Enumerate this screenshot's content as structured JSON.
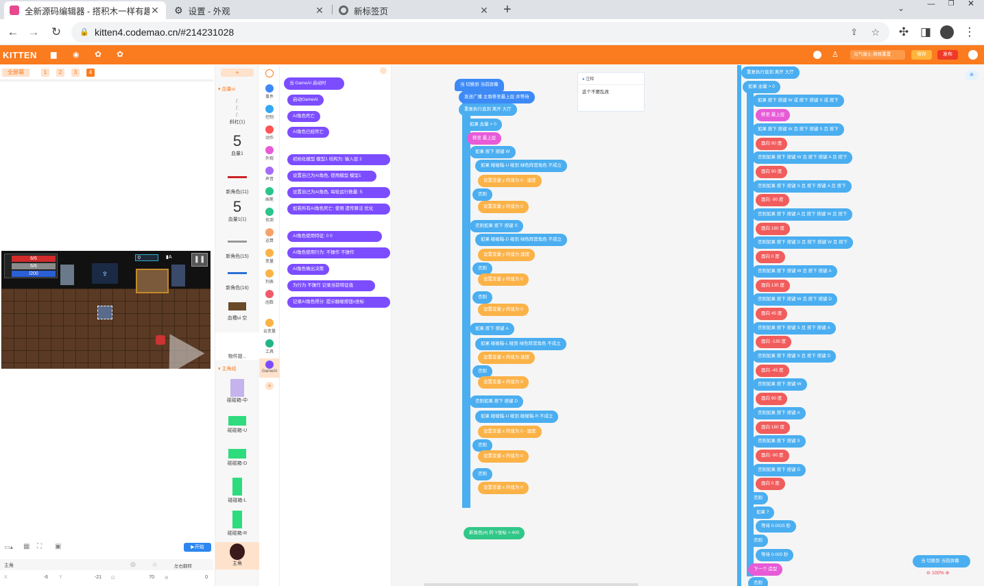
{
  "browser": {
    "tabs": [
      {
        "title": "全新源码编辑器 - 搭积木一样有趣",
        "active": true
      },
      {
        "title": "设置 - 外观",
        "active": false
      },
      {
        "title": "新标签页",
        "active": false
      }
    ],
    "url": "kitten4.codemao.cn/#214231028"
  },
  "app": {
    "logo": "KITTEN",
    "right_badge": "元气骑士-救赎重置",
    "save": "保存",
    "publish": "发布"
  },
  "stage": {
    "fullscreen_label": "全屏幕",
    "scenes": [
      "1",
      "2",
      "3",
      "4"
    ],
    "hud": {
      "hp": "6/6",
      "armor": "6/6",
      "energy": "/200",
      "ammo": "0",
      "key": "A"
    },
    "start_button": "开始",
    "sprite_name": "主角",
    "rotate_label": "左右翻转",
    "x_label": "X",
    "x_value": "-6",
    "y_label": "Y",
    "y_value": "-21",
    "size_value": "70",
    "dir_value": "0"
  },
  "sprites": [
    {
      "label": "血量ui"
    },
    {
      "label": "斜杠(1)"
    },
    {
      "label": "血量1"
    },
    {
      "label": "新角色(11)"
    },
    {
      "label": "血量1(1)"
    },
    {
      "label": "新角色(15)"
    },
    {
      "label": "新角色(16)"
    },
    {
      "label": "血槽ui 空"
    },
    {
      "label": "物件提..."
    },
    {
      "label": "主角组"
    },
    {
      "label": "碰碰箱-中"
    },
    {
      "label": "碰碰箱-U"
    },
    {
      "label": "碰碰箱-D"
    },
    {
      "label": "碰碰箱-L"
    },
    {
      "label": "碰碰箱-R"
    },
    {
      "label": "主角"
    }
  ],
  "categories": [
    "事件",
    "控制",
    "动作",
    "外观",
    "声音",
    "画笔",
    "侦测",
    "运算",
    "变量",
    "列表",
    "函数",
    "云变量",
    "工具",
    "GameAI"
  ],
  "palette": [
    "当 GameAI 启动时",
    "启动GameAI",
    "AI角色死亡",
    "AI角色已经死亡",
    "初始化模型 模型1 结构为: 输入层 2",
    "设置自己为AI角色, 使用模型 模型1",
    "设置自己为AI角色, 每轮运行数量: 5",
    "如若所有AI角色死亡: 使用 遗传算法 优化",
    "AI角色使用特征: 0 0",
    "AI角色使用行为: 不操作 不操作",
    "AI角色做出决策",
    "为行为 不操作 记录当前特征值",
    "记录AI角色得分: 提示触碰按钮x坐标"
  ],
  "workspace": {
    "comment_title": "注释",
    "comment_text": "这个不要乱改",
    "col1": [
      "当 切换到 当前屏幕",
      "发送广播 主角移至最上层 并等待",
      "重复执行直到 离开 大厅",
      "如果 血量 > 0",
      "移至 最上层",
      "如果 按下 按键 W",
      "如果 碰碰箱-U 碰到 绿色阵营角色 不成立",
      "设置变量 y 的值为 0 - 速度",
      "否则",
      "设置变量 y 的值为 0",
      "否则如果 按下 按键 S",
      "如果 碰碰箱-D 碰到 绿色阵营角色 不成立",
      "设置变量 y 的值为 速度",
      "否则",
      "设置变量 y 的值为 0",
      "否则",
      "设置变量 y 的值为 0",
      "如果 按下 按键 A",
      "如果 碰碰箱-L 碰到 绿色阵营角色 不成立",
      "设置变量 x 的值为 速度",
      "否则",
      "设置变量 x 的值为 0",
      "否则如果 按下 按键 D",
      "如果 碰碰箱-U 碰到 碰碰箱-R 不成立",
      "设置变量 x 的值为 0 - 速度",
      "否则",
      "设置变量 x 的值为 0",
      "否则",
      "设置变量 x 的值为 0",
      "新角色(4) 的 Y坐标 > 400"
    ],
    "col2": [
      "重复执行直到 离开 大厅",
      "如果 血量 > 0",
      "如果 按下 按键 W 或 按下 按键 S 或 按下",
      "移至 最上层",
      "如果 按下 按键 W 且 按下 按键 S 且 按下",
      "面向 90 度",
      "否则如果 按下 按键 W 且 按下 按键 A 且 按下",
      "面向 90 度",
      "否则如果 按下 按键 S 且 按下 按键 A 且 按下",
      "面向 -90 度",
      "否则如果 按下 按键 A 且 按下 按键 W 且 按下",
      "面向 180 度",
      "否则如果 按下 按键 D 且 按下 按键 W 且 按下",
      "面向 0 度",
      "否则如果 按下 按键 W 且 按下 按键 A",
      "面向 135 度",
      "否则如果 按下 按键 W 且 按下 按键 D",
      "面向 45 度",
      "否则如果 按下 按键 S 且 按下 按键 A",
      "面向 -135 度",
      "否则如果 按下 按键 S 且 按下 按键 D",
      "面向 -45 度",
      "否则如果 按下 按键 W",
      "面向 90 度",
      "否则如果 按下 按键 A",
      "面向 180 度",
      "否则如果 按下 按键 S",
      "面向 -90 度",
      "否则如果 按下 按键 D",
      "面向 0 度",
      "否则",
      "如果 ?",
      "等待 0.0025 秒",
      "否则",
      "等待 0.005 秒",
      "下一个 造型",
      "否则"
    ],
    "bottom_right_event": "当 切换到 当前屏幕",
    "zoom": "100%"
  }
}
